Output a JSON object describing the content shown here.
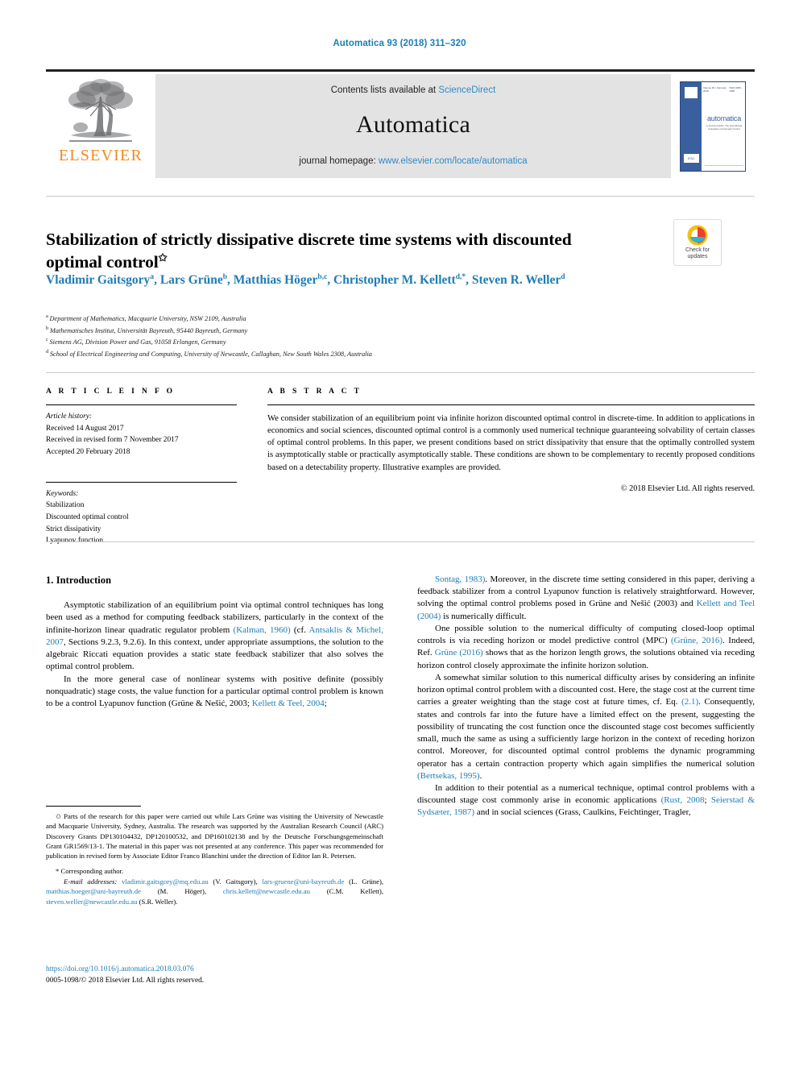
{
  "running_head": "Automatica 93 (2018) 311–320",
  "masthead": {
    "contents_prefix": "Contents lists available at ",
    "sciencedirect": "ScienceDirect",
    "journal_wordmark": "Automatica",
    "homepage_prefix": "journal homepage: ",
    "homepage_url": "www.elsevier.com/locate/automatica",
    "publisher_wordmark": "ELSEVIER",
    "cover": {
      "title": "automatica",
      "subtitle": "A Journal of IFAC, The International Federation of Automatic Control",
      "volume_line_left": "Volume 93 • February 2018",
      "volume_line_right": "ISSN 0005-1098",
      "imprint": "IFAC"
    }
  },
  "crossmark": {
    "label_line1": "Check for",
    "label_line2": "updates"
  },
  "article": {
    "title": "Stabilization of strictly dissipative discrete time systems with discounted optimal control",
    "title_marker": "✩",
    "authors": [
      {
        "name": "Vladimir Gaitsgory",
        "sup": "a",
        "sep": ", "
      },
      {
        "name": "Lars Grüne",
        "sup": "b",
        "sep": ", "
      },
      {
        "name": "Matthias Höger",
        "sup": "b,c",
        "sep": ", "
      },
      {
        "name": "Christopher M. Kellett",
        "sup": "d,*",
        "sep": ", "
      },
      {
        "name": "Steven R. Weller",
        "sup": "d",
        "sep": ""
      }
    ],
    "affiliations": [
      {
        "mark": "a",
        "text": "Department of Mathematics, Macquarie University, NSW 2109, Australia"
      },
      {
        "mark": "b",
        "text": "Mathematisches Institut, Universität Bayreuth, 95440 Bayreuth, Germany"
      },
      {
        "mark": "c",
        "text": "Siemens AG, Division Power and Gas, 91058 Erlangen, Germany"
      },
      {
        "mark": "d",
        "text": "School of Electrical Engineering and Computing, University of Newcastle, Callaghan, New South Wales 2308, Australia"
      }
    ]
  },
  "article_info": {
    "kicker": "A R T I C L E   I N F O",
    "history_label": "Article history:",
    "history": [
      "Received 14 August 2017",
      "Received in revised form 7 November 2017",
      "Accepted 20 February 2018"
    ],
    "keywords_label": "Keywords:",
    "keywords": [
      "Stabilization",
      "Discounted optimal control",
      "Strict dissipativity",
      "Lyapunov function"
    ]
  },
  "abstract": {
    "kicker": "A B S T R A C T",
    "text": "We consider stabilization of an equilibrium point via infinite horizon discounted optimal control in discrete-time. In addition to applications in economics and social sciences, discounted optimal control is a commonly used numerical technique guaranteeing solvability of certain classes of optimal control problems. In this paper, we present conditions based on strict dissipativity that ensure that the optimally controlled system is asymptotically stable or practically asymptotically stable. These conditions are shown to be complementary to recently proposed conditions based on a detectability property. Illustrative examples are provided.",
    "copyright": "© 2018 Elsevier Ltd. All rights reserved."
  },
  "body": {
    "section_heading": "1. Introduction",
    "left_paragraphs": [
      "Asymptotic stabilization of an equilibrium point via optimal control techniques has long been used as a method for computing feedback stabilizers, particularly in the context of the infinite-horizon linear quadratic regulator problem (Kalman, 1960) (cf. Antsaklis & Michel, 2007, Sections 9.2.3, 9.2.6). In this context, under appropriate assumptions, the solution to the algebraic Riccati equation provides a static state feedback stabilizer that also solves the optimal control problem.",
      "In the more general case of nonlinear systems with positive definite (possibly nonquadratic) stage costs, the value function for a particular optimal control problem is known to be a control Lyapunov function (Grüne & Nešić, 2003; Kellett & Teel, 2004;"
    ],
    "right_paragraphs": [
      "Sontag, 1983). Moreover, in the discrete time setting considered in this paper, deriving a feedback stabilizer from a control Lyapunov function is relatively straightforward. However, solving the optimal control problems posed in Grüne and Nešić (2003) and Kellett and Teel (2004) is numerically difficult.",
      "One possible solution to the numerical difficulty of computing closed-loop optimal controls is via receding horizon or model predictive control (MPC) (Grüne, 2016). Indeed, Ref. Grüne (2016) shows that as the horizon length grows, the solutions obtained via receding horizon control closely approximate the infinite horizon solution.",
      "A somewhat similar solution to this numerical difficulty arises by considering an infinite horizon optimal control problem with a discounted cost. Here, the stage cost at the current time carries a greater weighting than the stage cost at future times, cf. Eq. (2.1). Consequently, states and controls far into the future have a limited effect on the present, suggesting the possibility of truncating the cost function once the discounted stage cost becomes sufficiently small, much the same as using a sufficiently large horizon in the context of receding horizon control. Moreover, for discounted optimal control problems the dynamic programming operator has a certain contraction property which again simplifies the numerical solution (Bertsekas, 1995).",
      "In addition to their potential as a numerical technique, optimal control problems with a discounted stage cost commonly arise in economic applications (Rust, 2008; Seierstad & Sydsæter, 1987) and in social sciences (Grass, Caulkins, Feichtinger, Tragler,"
    ]
  },
  "footnotes": {
    "funding_marker": "✩",
    "funding": "Parts of the research for this paper were carried out while Lars Grüne was visiting the University of Newcastle and Macquarie University, Sydney, Australia. The research was supported by the Australian Research Council (ARC) Discovery Grants DP130104432, DP120100532, and DP160102138 and by the Deutsche Forschungsgemeinschaft Grant GR1569/13-1. The material in this paper was not presented at any conference. This paper was recommended for publication in revised form by Associate Editor Franco Blanchini under the direction of Editor Ian R. Petersen.",
    "corresponding": "* Corresponding author.",
    "email_label": "E-mail addresses:",
    "emails": [
      {
        "address": "vladimir.gaitsgory@mq.edu.au",
        "owner": " (V. Gaitsgory), "
      },
      {
        "address": "lars-gruene@uni-bayreuth.de",
        "owner": " (L. Grüne), "
      },
      {
        "address": "matthias.hoeger@uni-bayreuth.de",
        "owner": " (M. Höger), "
      },
      {
        "address": "chris.kellett@newcastle.edu.au",
        "owner": " (C.M. Kellett), "
      },
      {
        "address": "steven.weller@newcastle.edu.au",
        "owner": " (S.R. Weller)."
      }
    ]
  },
  "imprint": {
    "doi": "https://doi.org/10.1016/j.automatica.2018.03.076",
    "issn_line": "0005-1098/© 2018 Elsevier Ltd. All rights reserved."
  },
  "colors": {
    "link": "#1f7cb4",
    "elsevier_orange": "#f08a1d",
    "masthead_grey": "#e3e3e3",
    "cover_blue": "#3a5f9e"
  }
}
